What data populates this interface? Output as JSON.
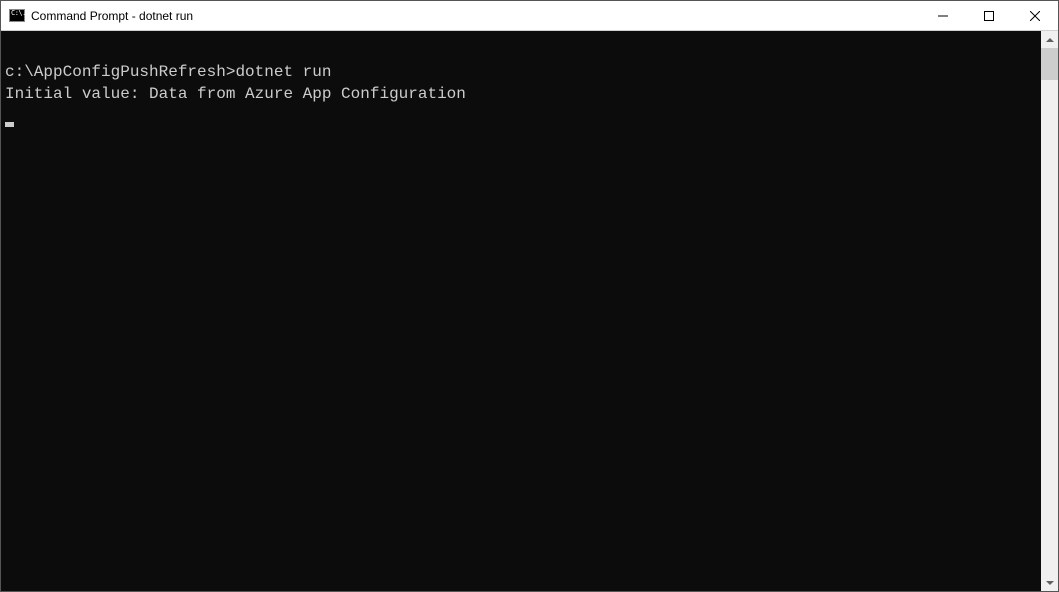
{
  "titlebar": {
    "title": "Command Prompt - dotnet  run",
    "icon_text": "C:\\."
  },
  "terminal": {
    "prompt_path": "c:\\AppConfigPushRefresh>",
    "command": "dotnet run",
    "output_line": "Initial value: Data from Azure App Configuration"
  }
}
